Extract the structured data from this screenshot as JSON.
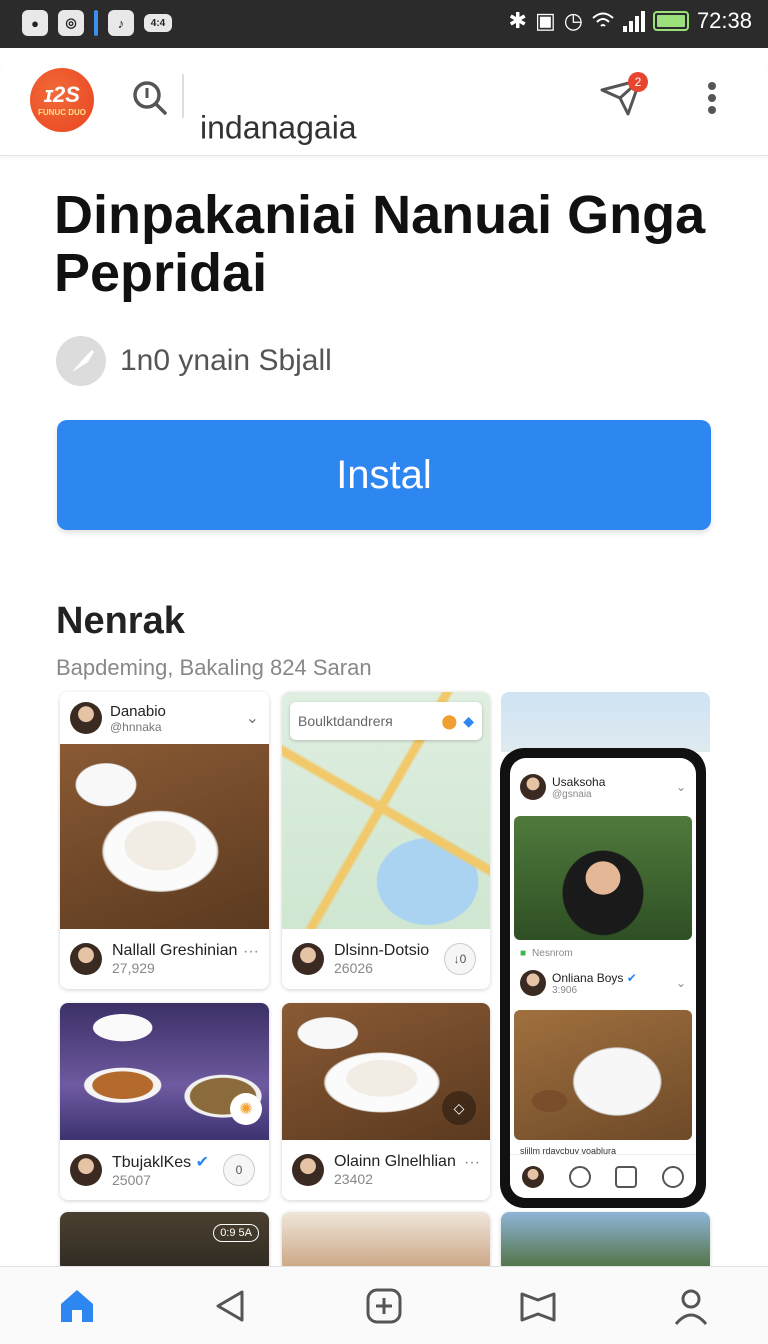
{
  "status_bar": {
    "time": "72:38",
    "notif_icon_text": "4:4"
  },
  "app_bar": {
    "logo_main": "ɪ2S",
    "logo_sub": "FUNUC DUO",
    "title": "indanagaia",
    "notification_count": "2"
  },
  "hero": {
    "headline": "Dinpakaniai Nanuai Gnga Pepridai",
    "meta_text": "1n0 ynain Sbjall",
    "install_label": "Instal"
  },
  "section": {
    "title": "Nenrak",
    "subtitle": "Bapdeming, Bakaling 824 Saran"
  },
  "cards": [
    {
      "user": "Danabio",
      "handle": "@hnnaka",
      "foot_name": "Nallall Greshinian",
      "foot_count": "27,929"
    },
    {
      "search_text": "Boulktdandrerя",
      "foot_name": "Dlsinn-Dotsio",
      "foot_count": "26026",
      "action": "↓0"
    },
    {
      "foot_name": "TbujaklKes",
      "foot_count": "25007",
      "action": "0"
    },
    {
      "foot_name": "Olainn Glnelhlian",
      "foot_count": "23402"
    }
  ],
  "phone": {
    "user1": "Usaksoha",
    "user1_sub": "@gsnaia",
    "likes_label": "Nesnrom",
    "user2": "Onliana Boys",
    "user2_sub": "3:906",
    "caption": "slillm rdaycbuy voablura"
  },
  "thumb_badge": "0:9 5A",
  "colors": {
    "accent": "#2e86f0",
    "brand": "#e8431f"
  }
}
